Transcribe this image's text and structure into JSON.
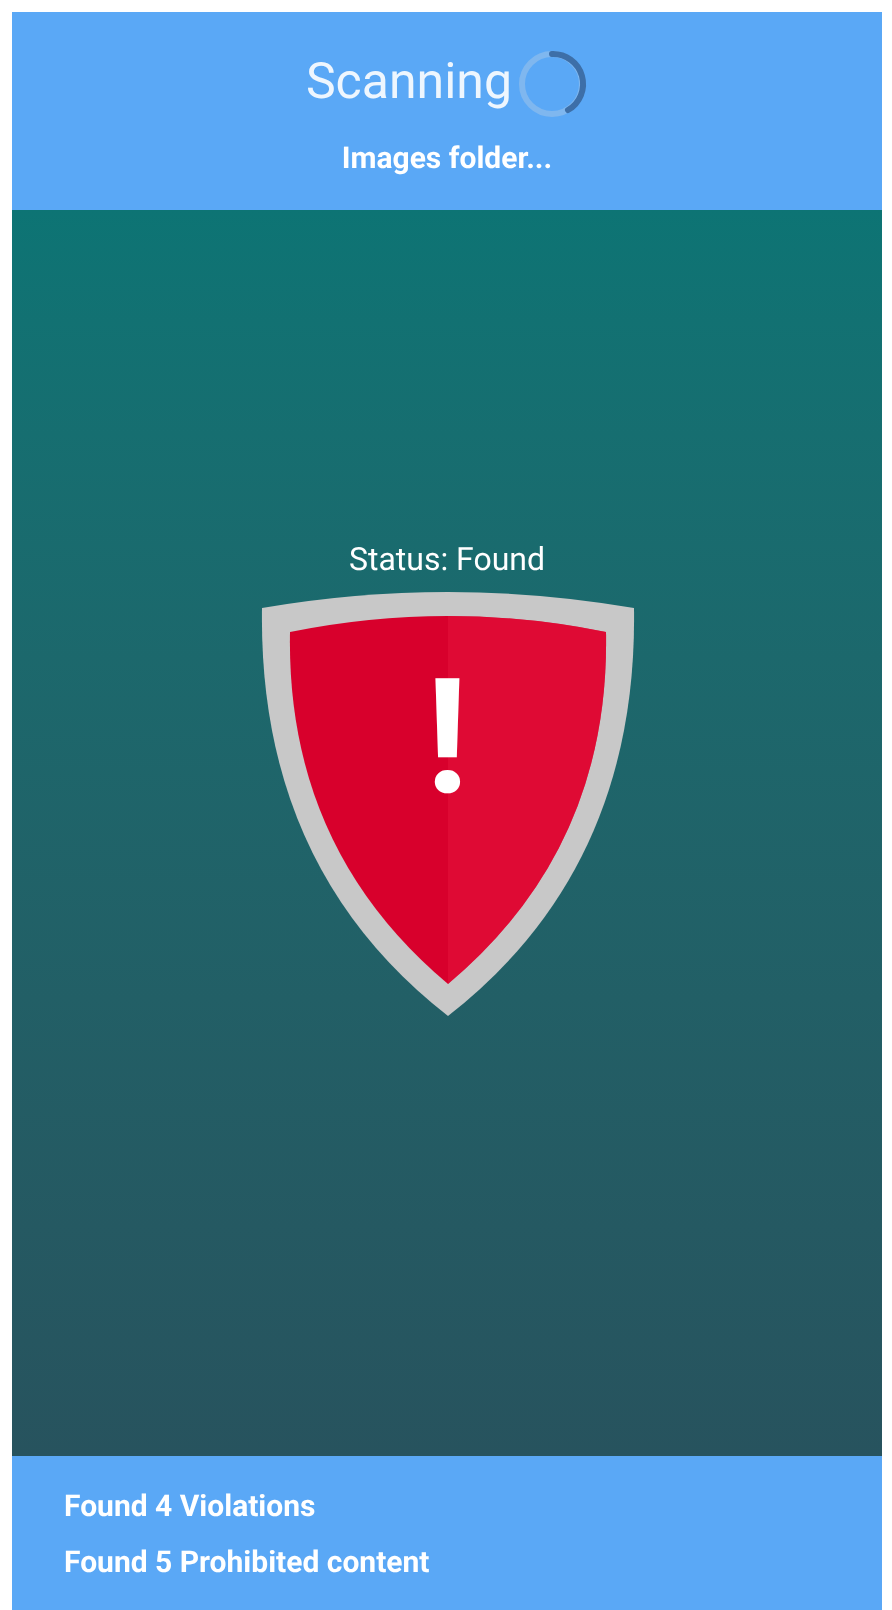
{
  "header": {
    "title": "Scanning",
    "busy": true,
    "subtitle": "Images folder..."
  },
  "status": {
    "label": "Status: Found",
    "shield_symbol": "!"
  },
  "findings": [
    {
      "text": "Found 4 Violations"
    },
    {
      "text": "Found 5 Prohibited content"
    }
  ]
}
